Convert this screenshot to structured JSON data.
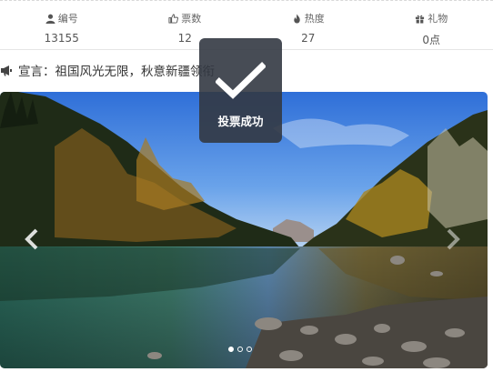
{
  "stats": [
    {
      "icon": "user-icon",
      "label": "编号",
      "value": "13155"
    },
    {
      "icon": "thumbs-up-icon",
      "label": "票数",
      "value": "12"
    },
    {
      "icon": "fire-icon",
      "label": "热度",
      "value": "27"
    },
    {
      "icon": "gift-icon",
      "label": "礼物",
      "value": "0点"
    }
  ],
  "slogan": {
    "icon": "megaphone-icon",
    "text": "宣言：祖国风光无限，秋意新疆领衔"
  },
  "toast": {
    "icon": "checkmark-icon",
    "message": "投票成功"
  },
  "carousel": {
    "slide_count": 3,
    "active_index": 0
  }
}
